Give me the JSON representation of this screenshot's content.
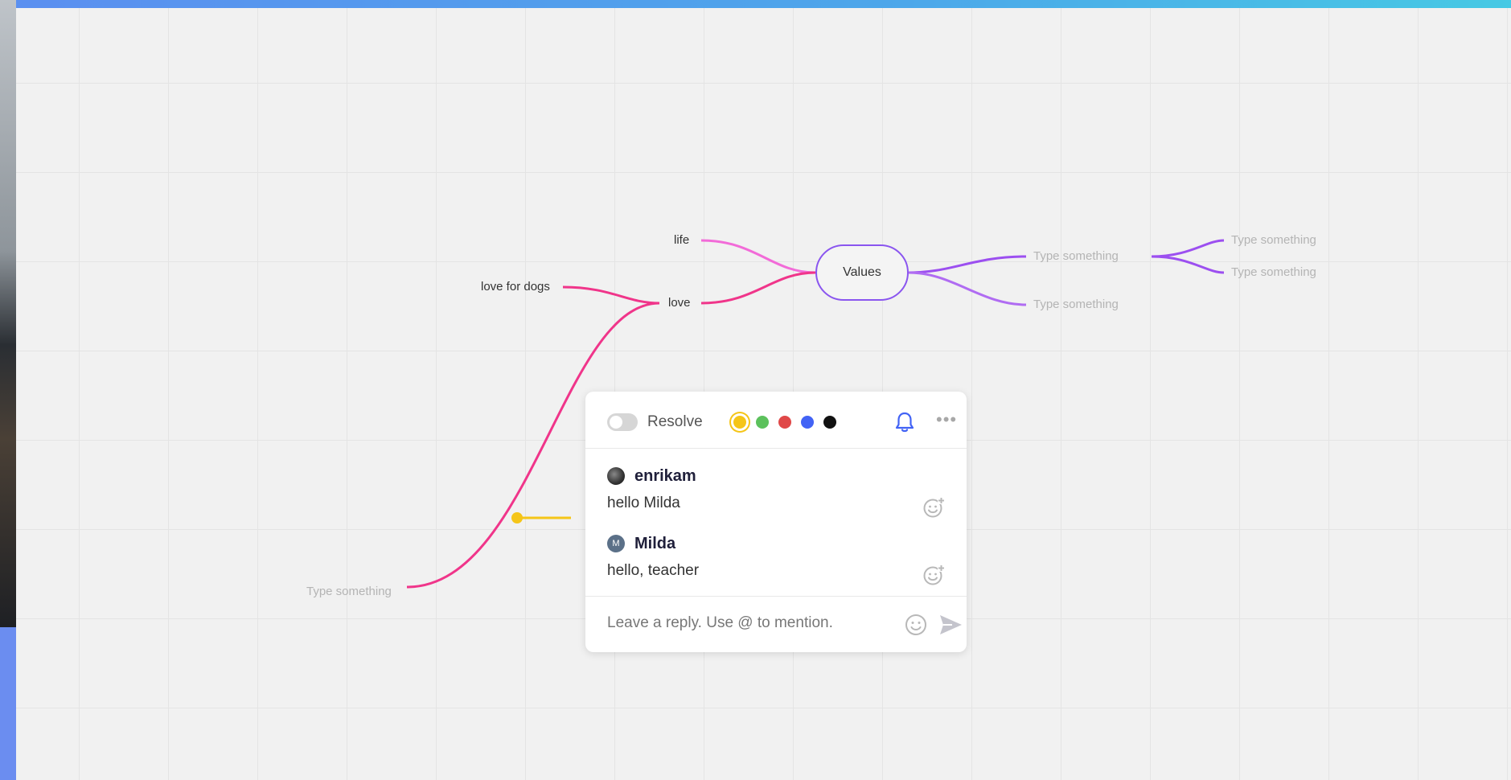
{
  "mindmap": {
    "root": "Values",
    "nodes": {
      "life": "life",
      "love": "love",
      "love_for_dogs": "love for dogs",
      "placeholder_left": "Type something",
      "placeholder_right_mid": "Type something",
      "placeholder_right_bottom": "Type something",
      "placeholder_far_top": "Type something",
      "placeholder_far_bottom": "Type something"
    },
    "colors": {
      "root_border": "#8a55ef",
      "right_branch": "#9c4ff0",
      "life_branch": "#f26bd8",
      "love_branch": "#f0358a",
      "connector": "#f5c518"
    }
  },
  "comment_card": {
    "resolve_label": "Resolve",
    "palette": [
      "#f5c518",
      "#5cc15c",
      "#e04848",
      "#4263f5",
      "#111111"
    ],
    "selected_color": "#f5c518",
    "comments": [
      {
        "author": "enrikam",
        "avatar": "photo",
        "text": "hello Milda"
      },
      {
        "author": "Milda",
        "avatar_initial": "M",
        "text": "hello, teacher"
      }
    ],
    "reply_placeholder": "Leave a reply. Use @ to mention."
  }
}
